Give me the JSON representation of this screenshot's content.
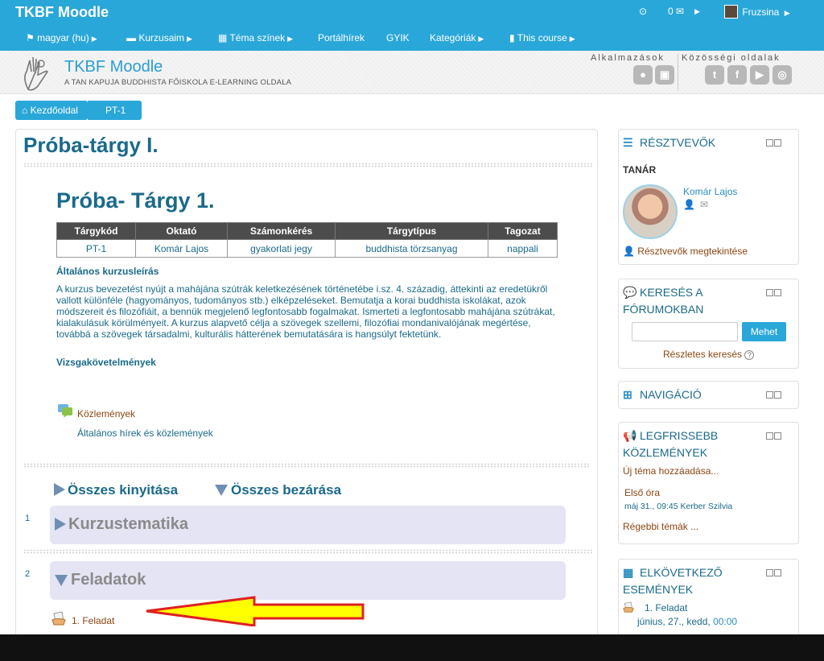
{
  "top": {
    "brand": "TKBF Moodle",
    "message_count": "0",
    "user_name": "Fruzsina",
    "menu": [
      "magyar (hu)",
      "Kurzusaim",
      "Téma színek",
      "Portálhírek",
      "GYIK",
      "Kategóriák",
      "This course"
    ]
  },
  "banner": {
    "site_name": "TKBF Moodle",
    "site_sub": "A TAN KAPUJA BUDDHISTA FŐISKOLA E-LEARNING OLDALA",
    "apps_label": "Alkalmazások",
    "social_label": "Közösségi oldalak"
  },
  "breadcrumb": {
    "home": "Kezdőoldal",
    "course": "PT-1"
  },
  "course": {
    "title": "Próba-tárgy I.",
    "subtitle": "Próba- Tárgy 1.",
    "table": {
      "headers": [
        "Tárgykód",
        "Oktató",
        "Számonkérés",
        "Tárgytípus",
        "Tagozat"
      ],
      "row": [
        "PT-1",
        "Komár Lajos",
        "gyakorlati jegy",
        "buddhista törzsanyag",
        "nappali"
      ]
    },
    "desc_heading": "Általános kurzusleírás",
    "desc_text": "A kurzus bevezetést nyújt a mahájána szútrák keletkezésének történetébe i.sz. 4. századig, áttekinti az eredetükről vallott különféle (hagyományos, tudományos stb.) elképzeléseket. Bemutatja a korai buddhista iskolákat, azok módszereit és filozófiáit, a bennük megjelenő legfontosabb fogalmakat. Ismerteti a legfontosabb mahájána szútrákat, kialakulásuk körülményeit. A kurzus alapvető célja a szövegek szellemi, filozófiai mondanivalójának megértése, továbbá a szövegek társadalmi, kulturális hátterének bemutatására is hangsúlyt fektetünk.",
    "req_heading": "Vizsgakövetelmények",
    "forum_link": "Közlemények",
    "forum_desc": "Általános hírek és közlemények",
    "expand_all": "Összes kinyitása",
    "collapse_all": "Összes bezárása",
    "sections": [
      {
        "num": "1",
        "title": "Kurzustematika"
      },
      {
        "num": "2",
        "title": "Feladatok"
      }
    ],
    "activity": "1. Feladat"
  },
  "blocks": {
    "participants": {
      "title": "RÉSZTVEVŐK",
      "role": "TANÁR",
      "teacher": "Komár Lajos",
      "view_link": "Résztvevők megtekintése"
    },
    "search": {
      "title_line1": "KERESÉS A",
      "title_line2": "FÓRUMOKBAN",
      "button": "Mehet",
      "advanced": "Részletes keresés"
    },
    "navigation": {
      "title": "NAVIGÁCIÓ"
    },
    "news": {
      "title_line1": "LEGFRISSEBB",
      "title_line2": "KÖZLEMÉNYEK",
      "add_topic": "Új téma hozzáadása...",
      "item_title": "Első óra",
      "item_date": "máj 31., 09:45",
      "item_author": "Kerber Szilvia",
      "older": "Régebbi témák ..."
    },
    "events": {
      "title_line1": "ELKÖVETKEZŐ",
      "title_line2": "ESEMÉNYEK",
      "event_title": "1. Feladat",
      "event_date": "június, 27., kedd,",
      "event_time": "00:00"
    }
  },
  "colors": {
    "navbar": "#2aa7d9",
    "title": "#1a6a8a",
    "link": "#8b4513",
    "section_bg": "#e4e4f4",
    "arrow_fill": "#ffff00",
    "arrow_stroke": "#e02020"
  }
}
